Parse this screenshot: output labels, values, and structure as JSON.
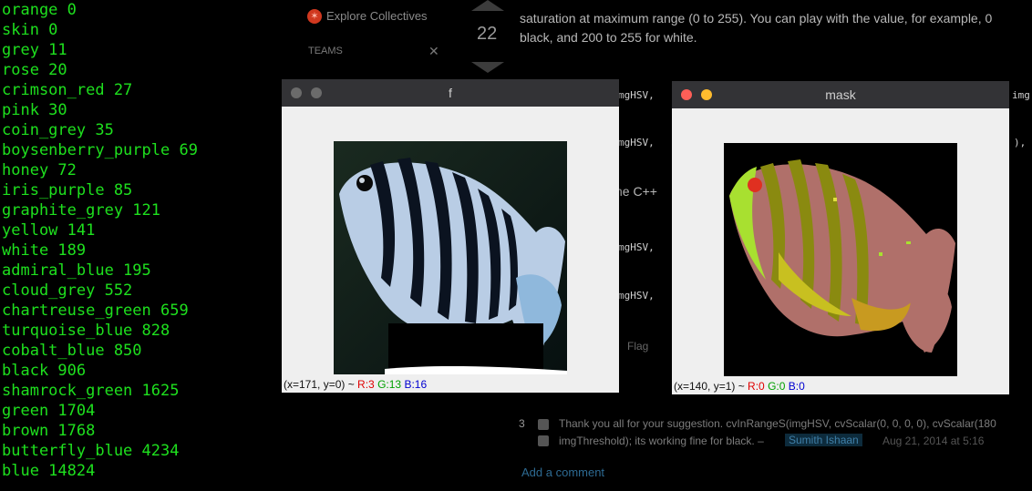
{
  "terminal": {
    "lines": [
      "orange 0",
      "skin 0",
      "grey 11",
      "rose 20",
      "crimson_red 27",
      "pink 30",
      "coin_grey 35",
      "boysenberry_purple 69",
      "honey 72",
      "iris_purple 85",
      "graphite_grey 121",
      "yellow 141",
      "white 189",
      "admiral_blue 195",
      "cloud_grey 552",
      "chartreuse_green 659",
      "turquoise_blue 828",
      "cobalt_blue 850",
      "black 906",
      "shamrock_green 1625",
      "green 1704",
      "brown 1768",
      "butterfly_blue 4234",
      "blue 14824"
    ]
  },
  "background_page": {
    "explore_collectives": "Explore Collectives",
    "teams": "TEAMS",
    "vote_count": "22",
    "answer_line1": "saturation at maximum range (0 to 255). You can play with the value, for example, 0",
    "answer_line2": "black, and 200 to 255 for white.",
    "code_snip1": "mgHSV,",
    "code_snip2": "mgHSV,",
    "code_snip3": "mgHSV,",
    "code_snip4": "mgHSV,",
    "code_right1": "img",
    "code_right2": "),",
    "cpp_text": "he C++",
    "flag": "Flag",
    "comment_vote": "3",
    "comment_line1": "Thank you all for your suggestion. cvInRangeS(imgHSV, cvScalar(0, 0, 0, 0), cvScalar(180",
    "comment_line2": "imgThreshold); its working fine for black. –",
    "comment_user": "Sumith Ishaan",
    "comment_date": "Aug 21, 2014 at 5:16",
    "add_comment": "Add a comment"
  },
  "window_f": {
    "title": "f",
    "status": {
      "coords": "(x=171, y=0) ~ ",
      "r": "R:3",
      "g": "G:13",
      "b": "B:16"
    }
  },
  "window_mask": {
    "title": "mask",
    "status": {
      "coords": "(x=140, y=1) ~ ",
      "r": "R:0",
      "g": "G:0",
      "b": "B:0"
    }
  },
  "colors": {
    "terminal_text": "#1ee01e",
    "close_red": "#ff5f57",
    "minimize_yellow": "#febc2e",
    "inactive_button": "#6b6b6b"
  }
}
